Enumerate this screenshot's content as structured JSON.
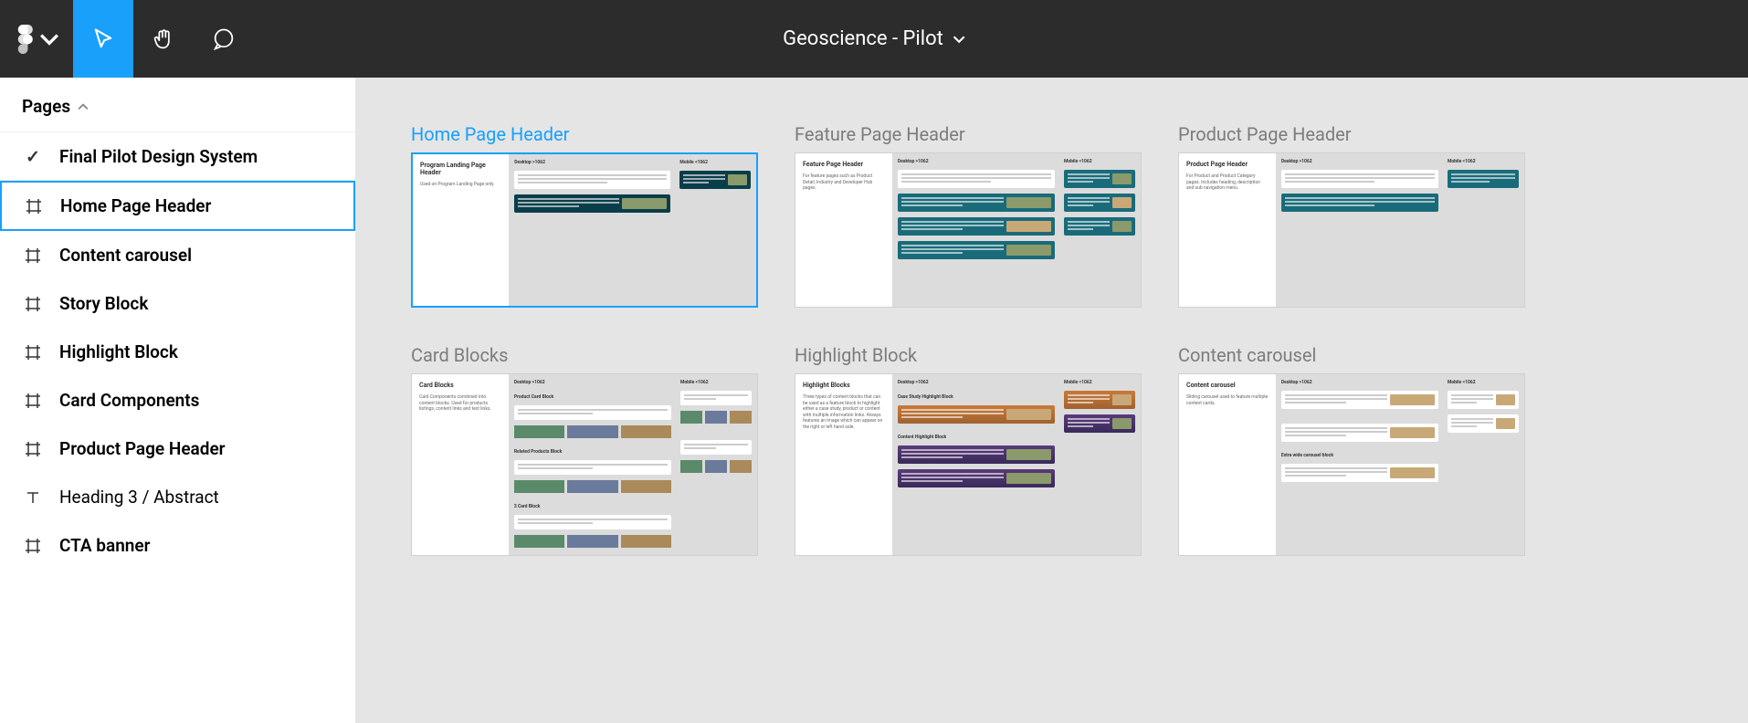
{
  "header": {
    "title": "Geoscience - Pilot"
  },
  "sidebar": {
    "section_label": "Pages",
    "items": [
      {
        "label": "Final Pilot Design System",
        "icon": "check",
        "style": "bold"
      },
      {
        "label": "Home Page Header",
        "icon": "frame",
        "style": "bold",
        "selected": true
      },
      {
        "label": "Content carousel",
        "icon": "frame",
        "style": "bold"
      },
      {
        "label": "Story Block",
        "icon": "frame",
        "style": "bold"
      },
      {
        "label": "Highlight Block",
        "icon": "frame",
        "style": "bold"
      },
      {
        "label": "Card Components",
        "icon": "frame",
        "style": "bold"
      },
      {
        "label": "Product Page Header",
        "icon": "frame",
        "style": "bold"
      },
      {
        "label": "Heading 3 / Abstract",
        "icon": "text",
        "style": "thin"
      },
      {
        "label": "CTA banner",
        "icon": "frame",
        "style": "bold"
      }
    ]
  },
  "canvas": {
    "frames": [
      {
        "title": "Home Page Header",
        "selected": true,
        "inner_title": "Program Landing Page Header",
        "inner_desc": "Used on Program Landing Page only.",
        "col1": "Desktop >1062",
        "col2": "Mobile <1062",
        "variant": "header-simple"
      },
      {
        "title": "Feature Page Header",
        "selected": false,
        "inner_title": "Feature Page Header",
        "inner_desc": "For feature pages such as Product Detail, Industry and Developer Hub pages.",
        "col1": "Desktop >1062",
        "col2": "Mobile <1062",
        "variant": "header-multi"
      },
      {
        "title": "Product Page Header",
        "selected": false,
        "inner_title": "Product Page Header",
        "inner_desc": "For Product and Product Category pages. Includes heading, description and sub navigation menu.",
        "col1": "Desktop >1062",
        "col2": "Mobile <1062",
        "variant": "header-product"
      },
      {
        "title": "Card Blocks",
        "selected": false,
        "inner_title": "Card Blocks",
        "inner_desc": "Card Components combined into content blocks. Used for products listings, content links and text links.",
        "col1": "Desktop >1062",
        "col2": "Mobile <1062",
        "variant": "cards",
        "tall": true
      },
      {
        "title": "Highlight Block",
        "selected": false,
        "inner_title": "Highlight Blocks",
        "inner_desc": "Three types of content blocks that can be used as a feature block to highlight either a case study, product or content with multiple information links. Always features an image which can appear on the right or left hand side.",
        "col1": "Desktop >1062",
        "col2": "Mobile <1062",
        "variant": "highlight",
        "tall": true
      },
      {
        "title": "Content carousel",
        "selected": false,
        "inner_title": "Content carousel",
        "inner_desc": "Sliding carousel used to feature multiple content cards.",
        "col1": "Desktop >1062",
        "col2": "Mobile <1062",
        "variant": "carousel",
        "tall": true
      }
    ]
  }
}
